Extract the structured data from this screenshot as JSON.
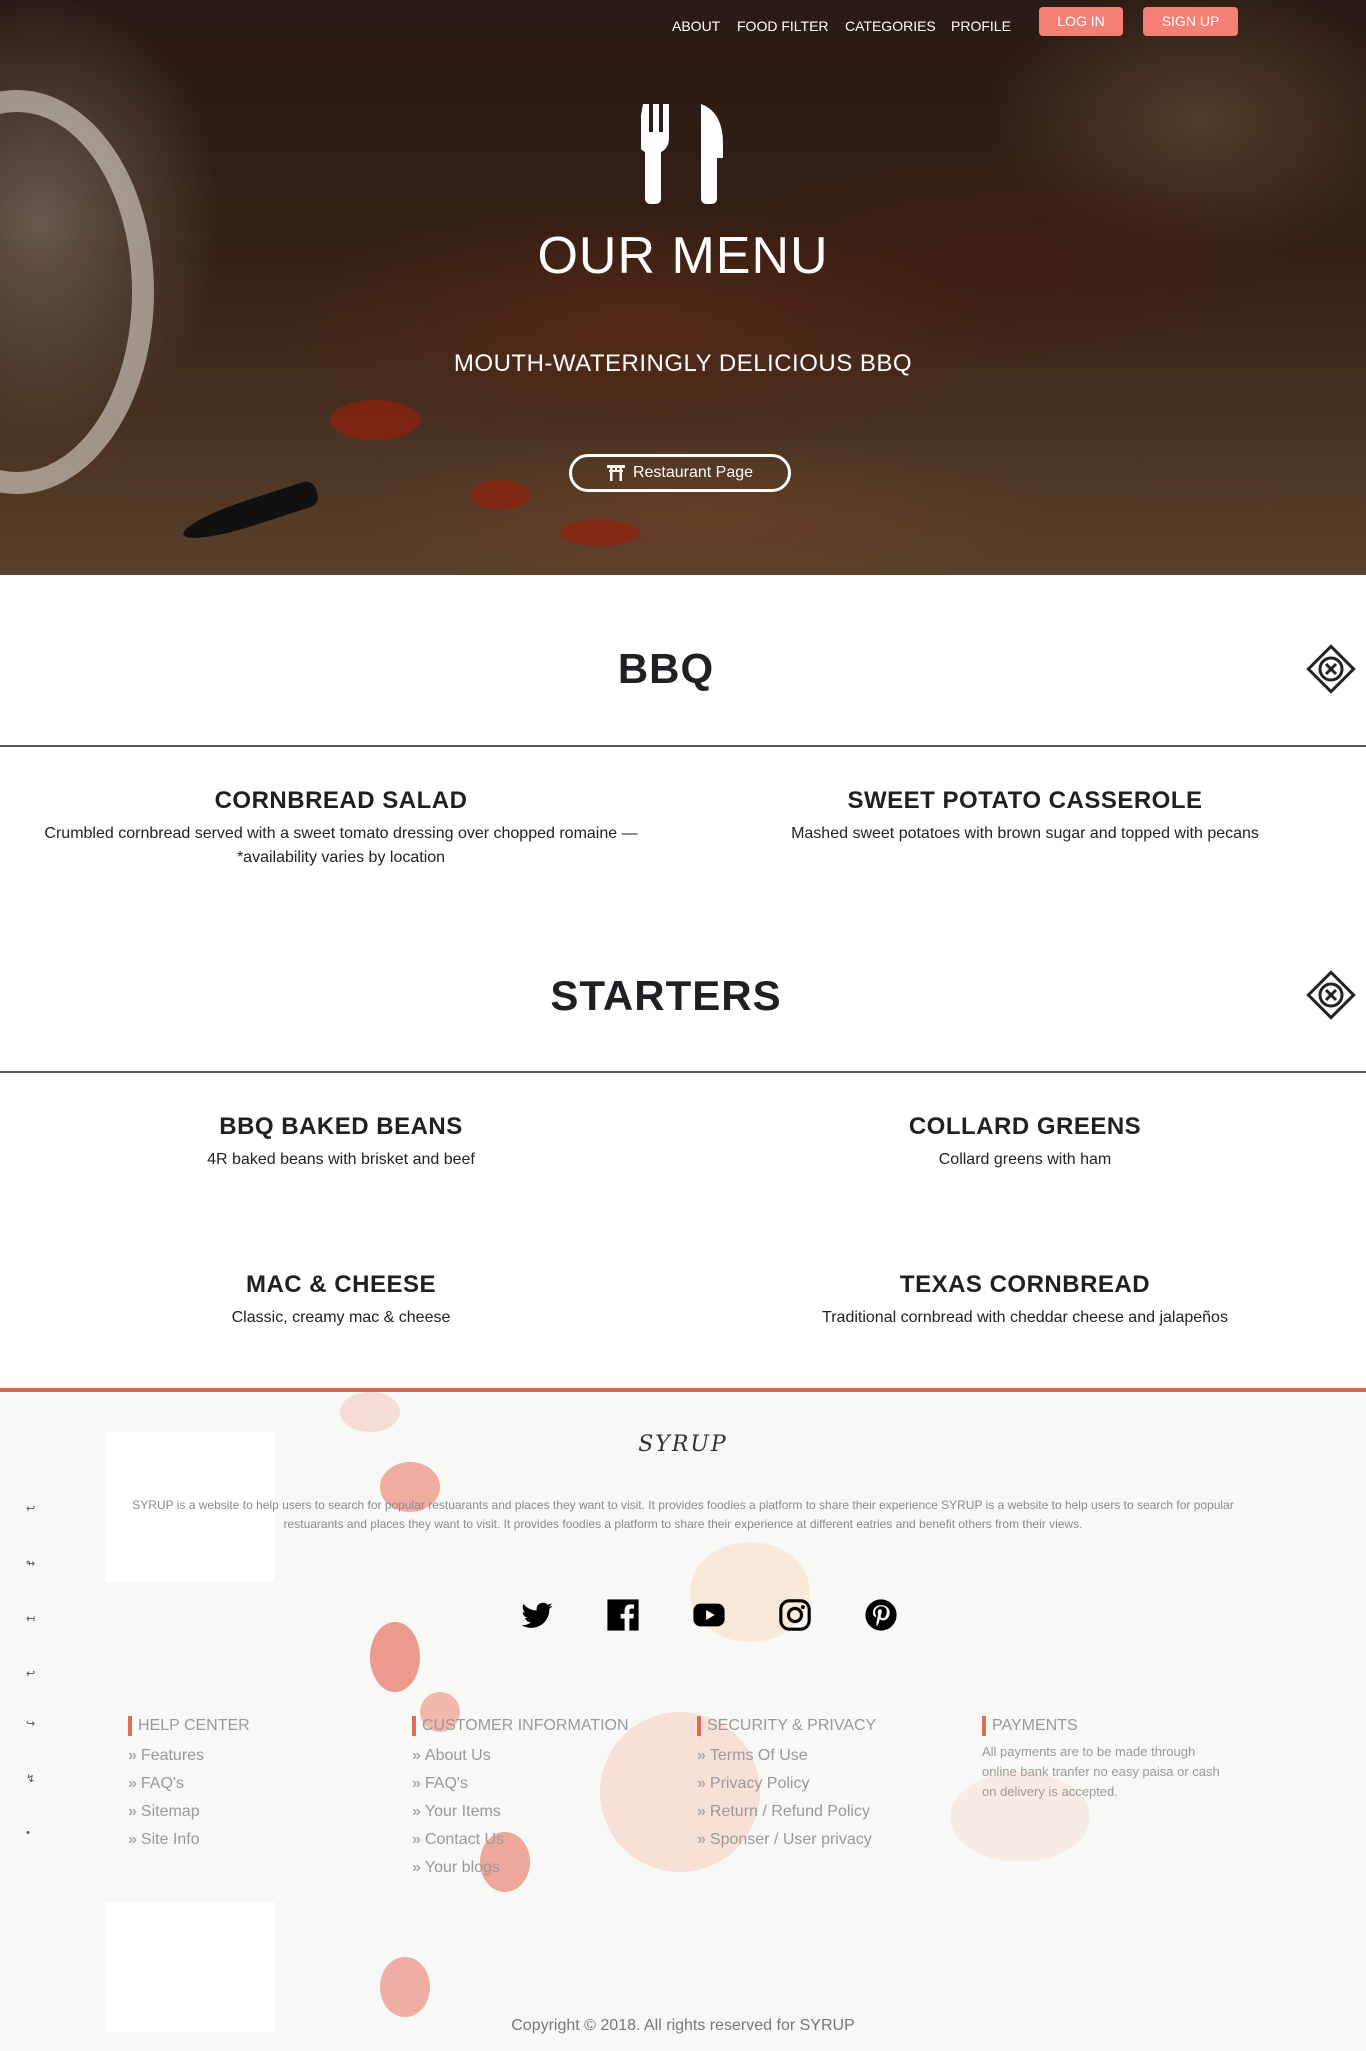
{
  "nav": {
    "links": [
      "ABOUT",
      "FOOD FILTER",
      "CATEGORIES",
      "PROFILE"
    ],
    "login_label": "LOG IN",
    "signup_label": "SIGN UP"
  },
  "hero": {
    "icon": "fork-knife-icon",
    "title": "OUR MENU",
    "subtitle": "MOUTH-WATERINGLY DELICIOUS BBQ",
    "button_label": "Restaurant Page",
    "button_icon": "torii-gate-icon"
  },
  "sections": [
    {
      "title": "BBQ",
      "items": [
        {
          "name": "CORNBREAD SALAD",
          "desc": "Crumbled cornbread served with a sweet tomato dressing over chopped romaine — *availability varies by location"
        },
        {
          "name": "SWEET POTATO CASSEROLE",
          "desc": "Mashed sweet potatoes with brown sugar and topped with pecans"
        }
      ]
    },
    {
      "title": "STARTERS",
      "items": [
        {
          "name": "BBQ BAKED BEANS",
          "desc": "4R baked beans with brisket and beef"
        },
        {
          "name": "COLLARD GREENS",
          "desc": "Collard greens with ham"
        },
        {
          "name": "MAC & CHEESE",
          "desc": "Classic, creamy mac & cheese"
        },
        {
          "name": "TEXAS CORNBREAD",
          "desc": "Traditional cornbread with cheddar cheese and jalapeños"
        }
      ]
    }
  ],
  "footer": {
    "logo": "SYRUP",
    "description": "SYRUP is a website to help users to search for popular restuarants and places they want to visit. It provides foodies a platform to share their experience SYRUP is a website to help users to search for popular restuarants and places they want to visit. It provides foodies a platform to share their experience at different eatries and benefit others from their views.",
    "social": [
      "twitter-icon",
      "facebook-icon",
      "youtube-icon",
      "instagram-icon",
      "pinterest-icon"
    ],
    "columns": [
      {
        "title": "HELP CENTER",
        "links": [
          "Features",
          "FAQ's",
          "Sitemap",
          "Site Info"
        ]
      },
      {
        "title": "CUSTOMER INFORMATION",
        "links": [
          "About Us",
          "FAQ's",
          "Your Items",
          "Contact Us",
          "Your blogs"
        ]
      },
      {
        "title": "SECURITY & PRIVACY",
        "links": [
          "Terms Of Use",
          "Privacy Policy",
          "Return / Refund Policy",
          "Sponser / User privacy"
        ]
      },
      {
        "title": "PAYMENTS",
        "text": "All payments are to be made through online bank tranfer no easy paisa or cash on delivery is accepted."
      }
    ],
    "copyright": "Copyright © 2018. All rights reserved for SYRUP"
  },
  "colors": {
    "accent": "#f47f74",
    "footer_rule": "#d36c55",
    "heading": "#1f1f24"
  }
}
